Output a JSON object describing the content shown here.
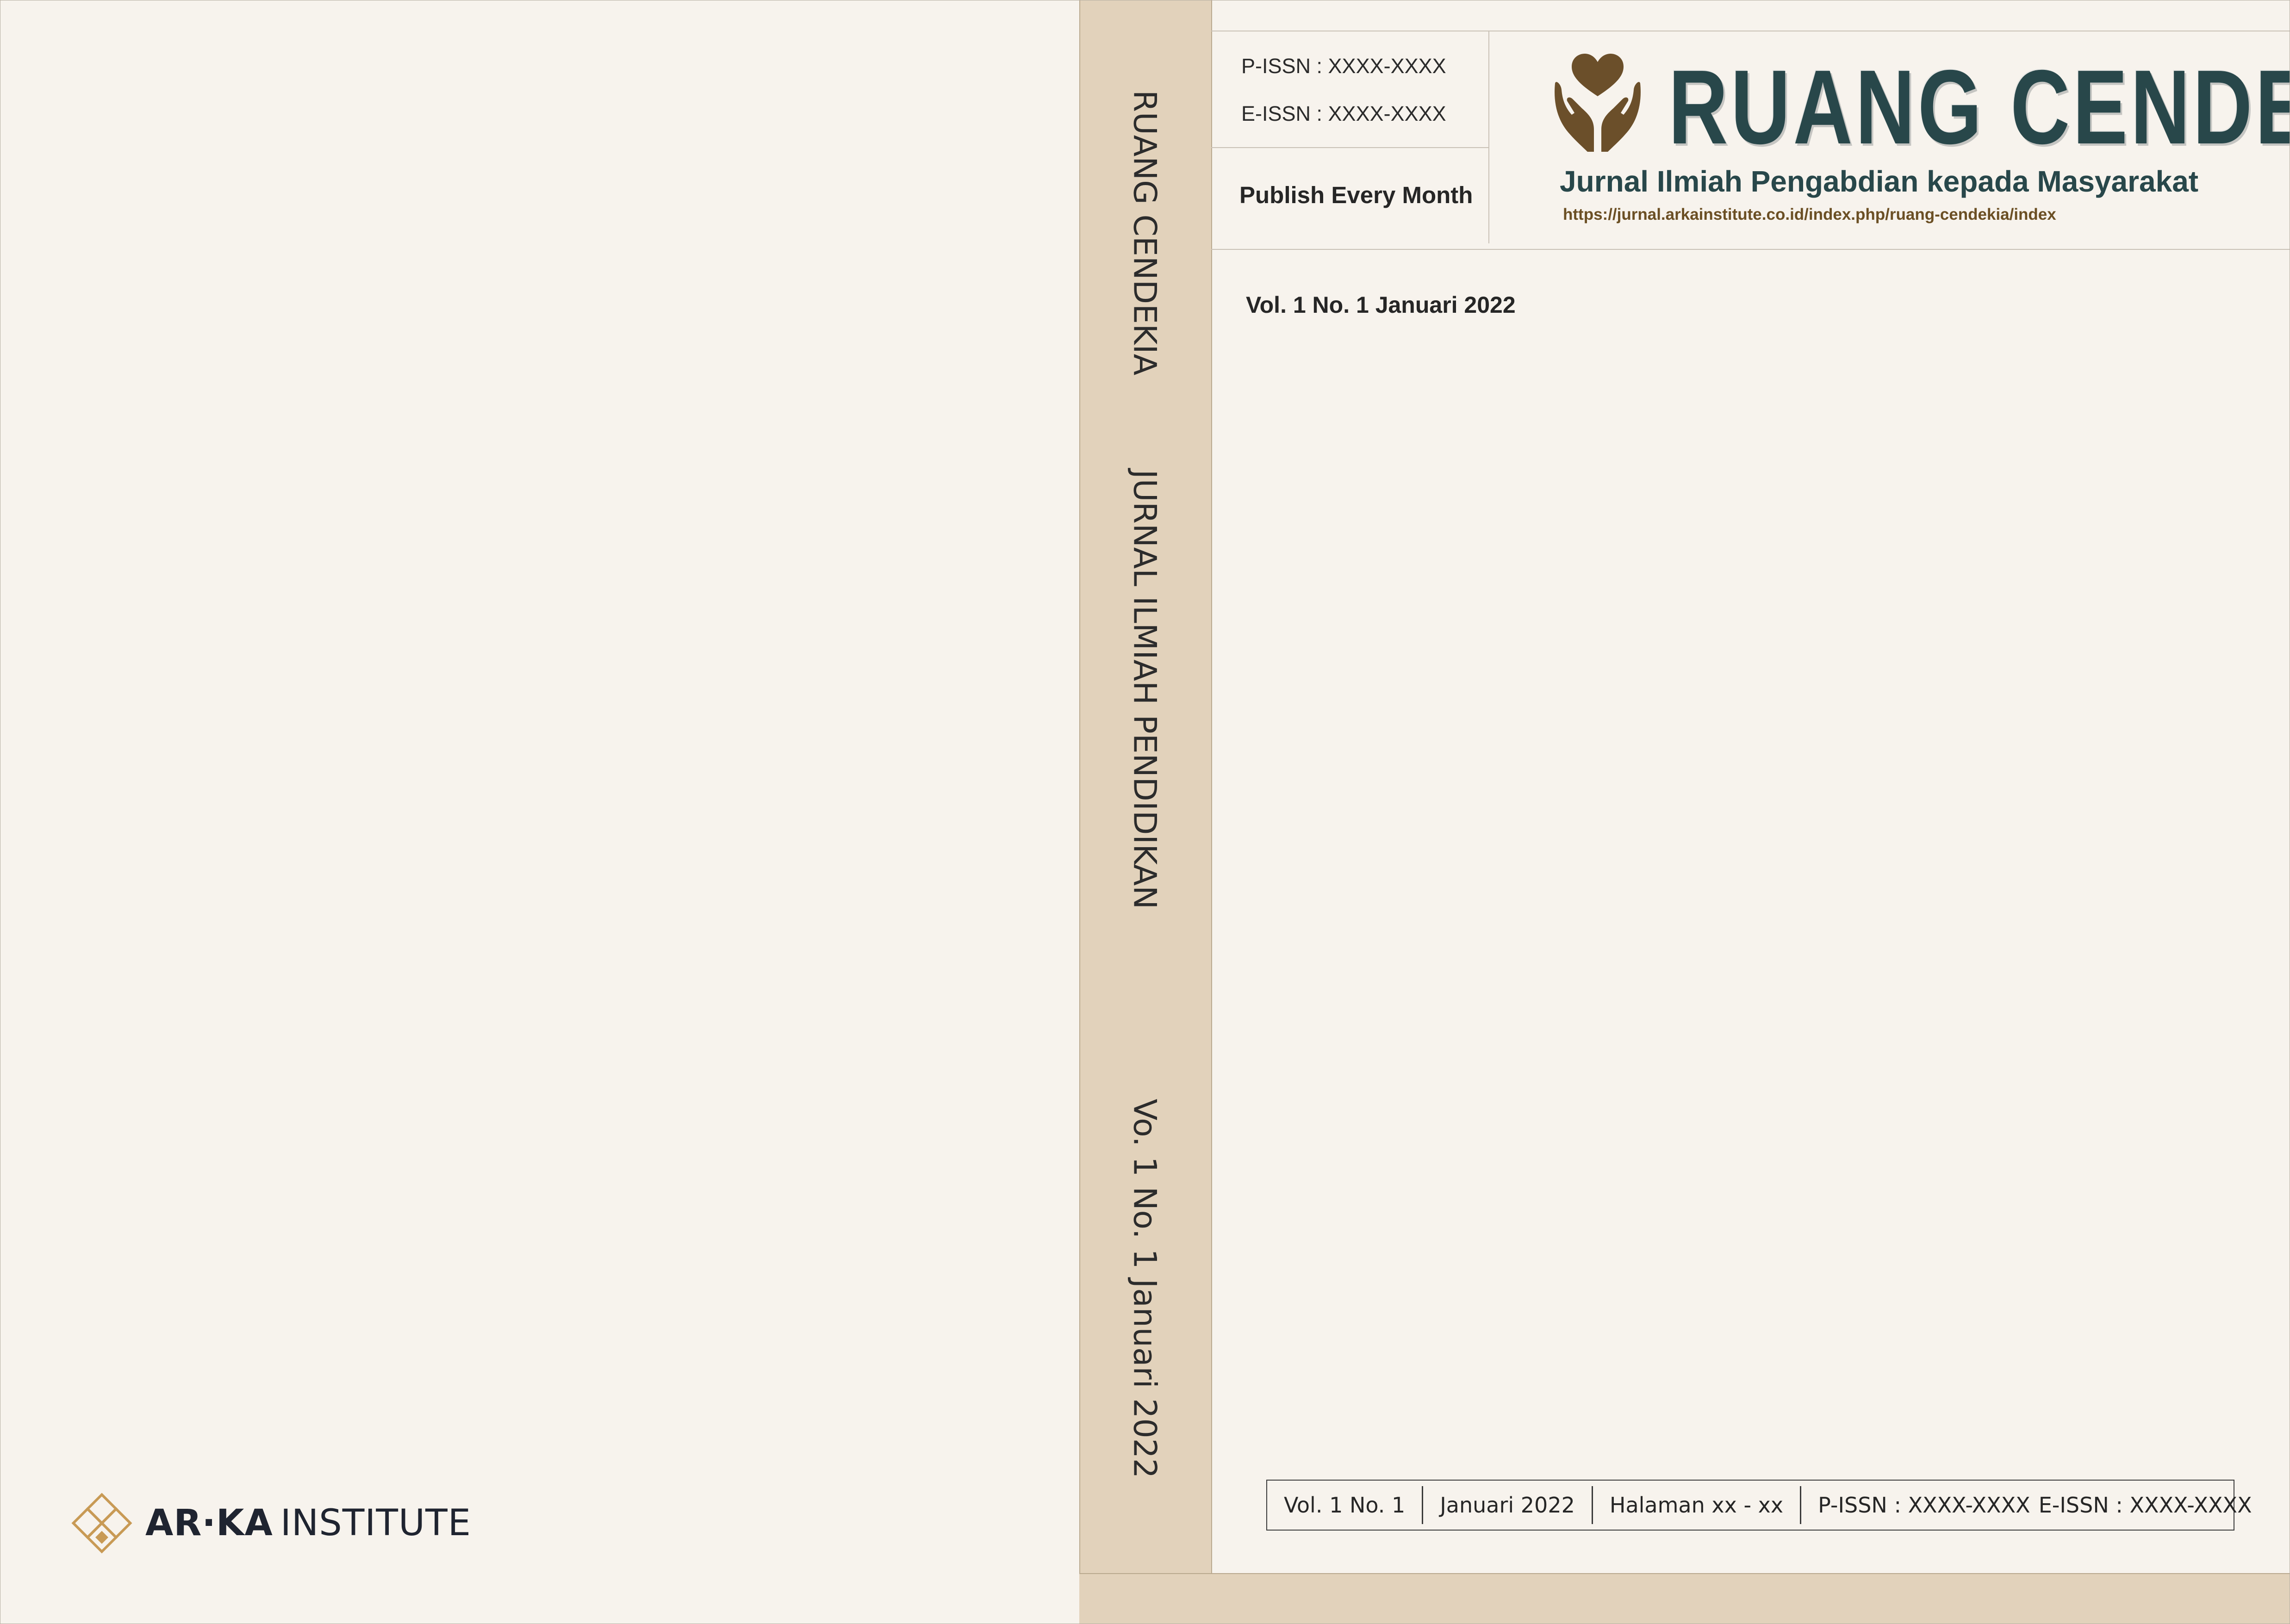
{
  "back_cover": {
    "publisher_logo": {
      "icon": "arka-diamond-knot-icon",
      "name_bold": "AR·KA",
      "name_regular": "INSTITUTE"
    }
  },
  "spine": {
    "journal_name": "RUANG CENDEKIA",
    "journal_subtitle": "JURNAL ILMIAH PENDIDIKAN",
    "issue": "Vo. 1 No. 1 Januari 2022"
  },
  "front_cover": {
    "p_issn": "P-ISSN : XXXX-XXXX",
    "e_issn": "E-ISSN : XXXX-XXXX",
    "frequency": "Publish Every Month",
    "brand": {
      "icon": "hands-holding-heart-icon",
      "title": "RUANG CENDEKIA",
      "subtitle": "Jurnal Ilmiah Pengabdian kepada Masyarakat",
      "url": "https://jurnal.arkainstitute.co.id/index.php/ruang-cendekia/index"
    },
    "volume": "Vol. 1 No. 1 Januari 2022",
    "footer": {
      "volume": "Vol. 1 No. 1",
      "date": "Januari 2022",
      "pages": "Halaman xx - xx",
      "p_issn": "P-ISSN : XXXX-XXXX",
      "e_issn": "E-ISSN : XXXX-XXXX"
    }
  },
  "colors": {
    "paper": "#f7f3ed",
    "spine": "#e2d2bb",
    "brand_teal": "#28474a",
    "brand_brown": "#6b4f24",
    "logo_gold": "#c89a55"
  }
}
